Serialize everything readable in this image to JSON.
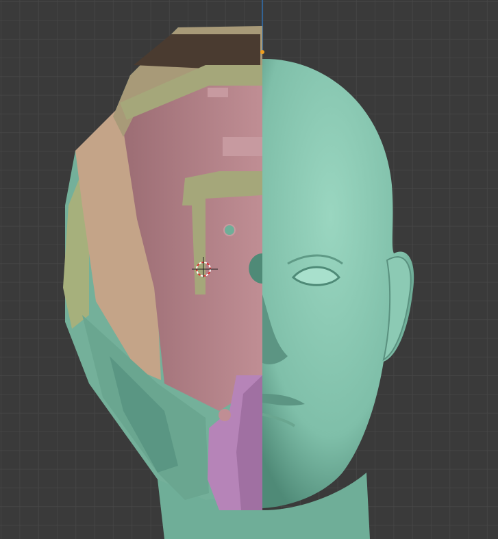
{
  "viewport": {
    "kind": "3d-viewport",
    "background": "#3a3a3a",
    "grid_color": "#474747",
    "axis_line_color": "#2f6fb0",
    "origin_color": "#f0a020"
  },
  "objects": [
    {
      "name": "head",
      "color": "#7fbfa9"
    },
    {
      "name": "helmet-shell-upper",
      "color": "#a89a78"
    },
    {
      "name": "helmet-visor-band",
      "color": "#a5a77a"
    },
    {
      "name": "helmet-inner-plate",
      "color": "#b07f86"
    },
    {
      "name": "helmet-side-panel",
      "color": "#c4a488"
    },
    {
      "name": "helmet-jaw-guard",
      "color": "#74b09a"
    },
    {
      "name": "helmet-chin-piece",
      "color": "#b684b8"
    },
    {
      "name": "helmet-ear-piece",
      "color": "#a6b07c"
    }
  ],
  "cursor": {
    "name": "3d-cursor",
    "colors": [
      "#e03030",
      "#ffffff"
    ]
  }
}
